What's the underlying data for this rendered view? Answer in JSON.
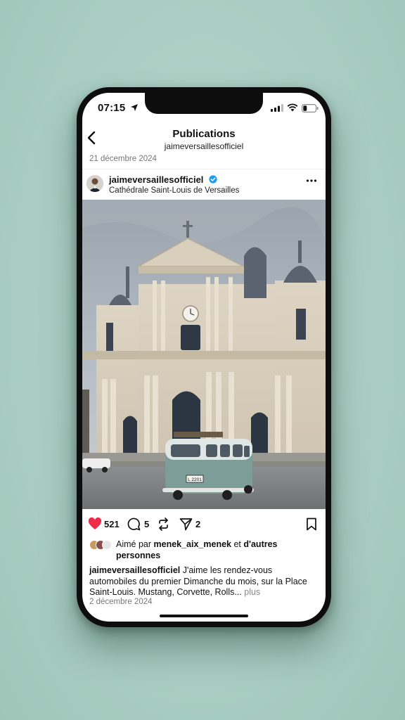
{
  "status": {
    "time": "07:15"
  },
  "header": {
    "title": "Publications",
    "subtitle": "jaimeversaillesofficiel"
  },
  "previous_post_date": "21 décembre 2024",
  "post": {
    "username": "jaimeversaillesofficiel",
    "location": "Cathédrale Saint-Louis de Versailles",
    "likes": "521",
    "comments": "5",
    "shares": "2",
    "liked_by_prefix": "Aimé par ",
    "liked_by_user": "menek_aix_menek",
    "liked_by_middle": " et ",
    "liked_by_others": "d'autres personnes",
    "caption_user": "jaimeversaillesofficiel",
    "caption_text": " J'aime les rendez-vous automobiles du premier Dimanche du mois, sur la Place Saint-Louis. Mustang, Corvette, Rolls...",
    "caption_more": " plus",
    "date": "2 décembre 2024",
    "license_plate": "L 2201"
  },
  "icons": [
    "location-arrow-icon",
    "signal-icon",
    "wifi-icon",
    "battery-icon",
    "back-chevron-icon",
    "verified-badge-icon",
    "more-options-icon",
    "heart-icon",
    "comment-icon",
    "repost-icon",
    "send-icon",
    "bookmark-icon"
  ],
  "colors": {
    "background": "#a9cdc2",
    "heart": "#ed2d47",
    "verified": "#1f9bf0"
  }
}
